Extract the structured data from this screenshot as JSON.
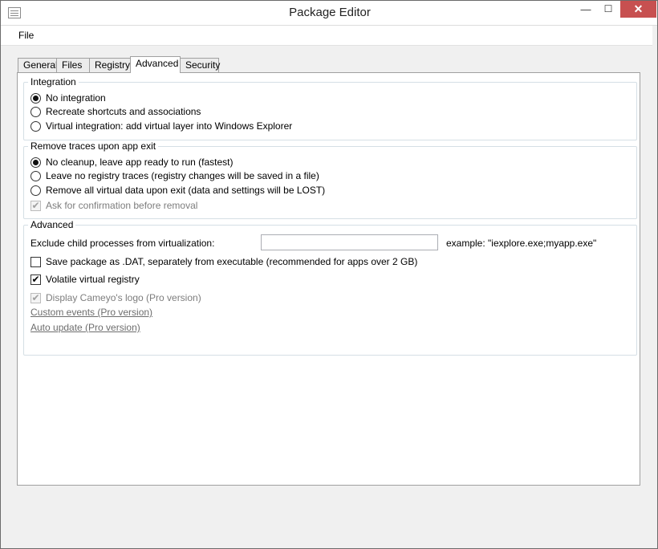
{
  "window": {
    "title": "Package Editor",
    "minimize_glyph": "—",
    "maximize_glyph": "☐",
    "close_glyph": "✕"
  },
  "menu": {
    "file": "File"
  },
  "tabs": [
    {
      "label": "General",
      "active": false
    },
    {
      "label": "Files",
      "active": false
    },
    {
      "label": "Registry",
      "active": false
    },
    {
      "label": "Advanced",
      "active": true
    },
    {
      "label": "Security",
      "active": false
    }
  ],
  "integration": {
    "legend": "Integration",
    "options": [
      {
        "label": "No integration",
        "checked": true
      },
      {
        "label": "Recreate shortcuts and associations",
        "checked": false
      },
      {
        "label": "Virtual integration: add virtual layer into Windows Explorer",
        "checked": false
      }
    ]
  },
  "remove_traces": {
    "legend": "Remove traces upon app exit",
    "options": [
      {
        "label": "No cleanup, leave app ready to run (fastest)",
        "checked": true
      },
      {
        "label": "Leave no registry traces (registry changes will be saved in a file)",
        "checked": false
      },
      {
        "label": "Remove all virtual data upon exit (data and settings will be LOST)",
        "checked": false
      }
    ],
    "confirm_label": "Ask for confirmation before removal",
    "confirm_checked": true,
    "confirm_disabled": true
  },
  "advanced": {
    "legend": "Advanced",
    "exclude_label": "Exclude child processes from virtualization:",
    "exclude_value": "",
    "exclude_example": "example: \"iexplore.exe;myapp.exe\"",
    "save_dat_label": "Save package as .DAT, separately from executable (recommended for apps over 2 GB)",
    "save_dat_checked": false,
    "volatile_label": "Volatile virtual registry",
    "volatile_checked": true,
    "logo_label": "Display Cameyo's logo (Pro version)",
    "logo_checked": true,
    "custom_events_link": "Custom events (Pro version)",
    "auto_update_link": "Auto update (Pro version)"
  },
  "check_glyph": "✔"
}
